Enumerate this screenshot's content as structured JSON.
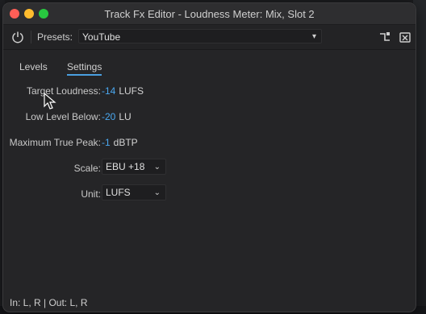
{
  "window": {
    "title": "Track Fx Editor - Loudness Meter: Mix, Slot 2"
  },
  "toolbar": {
    "presets_label": "Presets:",
    "presets_value": "YouTube"
  },
  "tabs": [
    {
      "label": "Levels",
      "active": false
    },
    {
      "label": "Settings",
      "active": true
    }
  ],
  "settings": {
    "target_loudness": {
      "label": "Target Loudness:",
      "value": "-14",
      "unit": "LUFS"
    },
    "low_level_below": {
      "label": "Low Level Below:",
      "value": "-20",
      "unit": "LU"
    },
    "max_true_peak": {
      "label": "Maximum True Peak:",
      "value": "-1",
      "unit": "dBTP"
    },
    "scale": {
      "label": "Scale:",
      "value": "EBU +18"
    },
    "unit": {
      "label": "Unit:",
      "value": "LUFS"
    }
  },
  "footer": {
    "io": "In: L, R | Out: L, R"
  },
  "colors": {
    "accent_value": "#4aa8f0",
    "window_bg": "#252527",
    "titlebar_bg": "#2e2e30"
  },
  "icons": {
    "power": "power-icon",
    "routing": "routing-icon",
    "close_fx": "close-box-icon",
    "chevron": "chevron-down-icon",
    "cursor": "mouse-pointer-icon"
  }
}
